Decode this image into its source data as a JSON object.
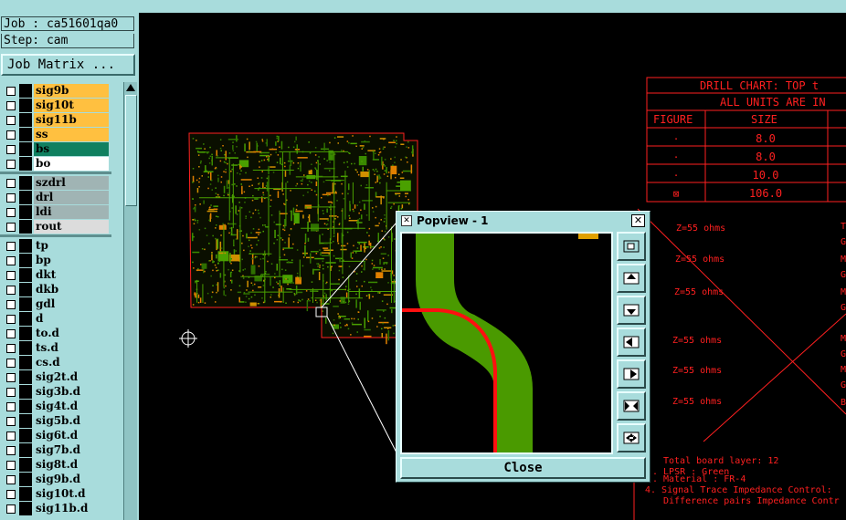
{
  "job_label": "Job : ca51601qa0",
  "step_label": "Step: cam",
  "job_matrix_label": "Job Matrix ...",
  "layers": [
    {
      "name": "sig9b",
      "color": "#ffc040"
    },
    {
      "name": "sig10t",
      "color": "#ffc040"
    },
    {
      "name": "sig11b",
      "color": "#ffc040"
    },
    {
      "name": "ss",
      "color": "#ffc040"
    },
    {
      "name": "bs",
      "color": "#108060"
    },
    {
      "name": "bo",
      "color": "#ffffff"
    },
    {
      "name": "szdrl",
      "color": "#a0b4b4"
    },
    {
      "name": "drl",
      "color": "#a0b4b4"
    },
    {
      "name": "ldi",
      "color": "#a0b4b4"
    },
    {
      "name": "rout",
      "color": "#dcdcdc"
    },
    {
      "name": "tp",
      "color": "#a8dcdc"
    },
    {
      "name": "bp",
      "color": "#a8dcdc"
    },
    {
      "name": "dkt",
      "color": "#a8dcdc"
    },
    {
      "name": "dkb",
      "color": "#a8dcdc"
    },
    {
      "name": "gdl",
      "color": "#a8dcdc"
    },
    {
      "name": "d",
      "color": "#a8dcdc"
    },
    {
      "name": "to.d",
      "color": "#a8dcdc"
    },
    {
      "name": "ts.d",
      "color": "#a8dcdc"
    },
    {
      "name": "cs.d",
      "color": "#a8dcdc"
    },
    {
      "name": "sig2t.d",
      "color": "#a8dcdc"
    },
    {
      "name": "sig3b.d",
      "color": "#a8dcdc"
    },
    {
      "name": "sig4t.d",
      "color": "#a8dcdc"
    },
    {
      "name": "sig5b.d",
      "color": "#a8dcdc"
    },
    {
      "name": "sig6t.d",
      "color": "#a8dcdc"
    },
    {
      "name": "sig7b.d",
      "color": "#a8dcdc"
    },
    {
      "name": "sig8t.d",
      "color": "#a8dcdc"
    },
    {
      "name": "sig9b.d",
      "color": "#a8dcdc"
    },
    {
      "name": "sig10t.d",
      "color": "#a8dcdc"
    },
    {
      "name": "sig11b.d",
      "color": "#a8dcdc"
    }
  ],
  "drill_chart": {
    "title": "DRILL CHART: TOP t",
    "subtitle": "ALL UNITS ARE IN",
    "col_figure": "FIGURE",
    "col_size": "SIZE",
    "rows": [
      {
        "figure": "·",
        "size": "8.0"
      },
      {
        "figure": "·",
        "size": "8.0"
      },
      {
        "figure": "·",
        "size": "10.0"
      },
      {
        "figure": "⊠",
        "size": "106.0"
      }
    ]
  },
  "impedance_labels": [
    "Z=55 ohms",
    "Z=55 ohms",
    "Z=55 ohms",
    "Z=55 ohms",
    "Z=55 ohms",
    "Z=55 ohms"
  ],
  "right_letters": [
    "T",
    "G",
    "M",
    "G",
    "M",
    "G",
    "M",
    "G",
    "M",
    "G",
    "B"
  ],
  "notes": [
    "Total board layer: 12",
    ". LPSR : Green",
    ". Material : FR-4",
    "4. Signal Trace Impedance Control:",
    "Difference pairs Impedance Contr"
  ],
  "popview": {
    "title": "Popview - 1",
    "close_label": "Close",
    "tools": [
      "zoom-fit-icon",
      "pan-up-icon",
      "pan-down-icon",
      "pan-left-icon",
      "pan-right-icon",
      "zoom-in-icon",
      "zoom-out-icon"
    ]
  },
  "colors": {
    "ui_bg": "#a8dcdc",
    "trace_green": "#4a9a00",
    "trace_red": "#ff1010",
    "board_outline": "#ff2020"
  }
}
